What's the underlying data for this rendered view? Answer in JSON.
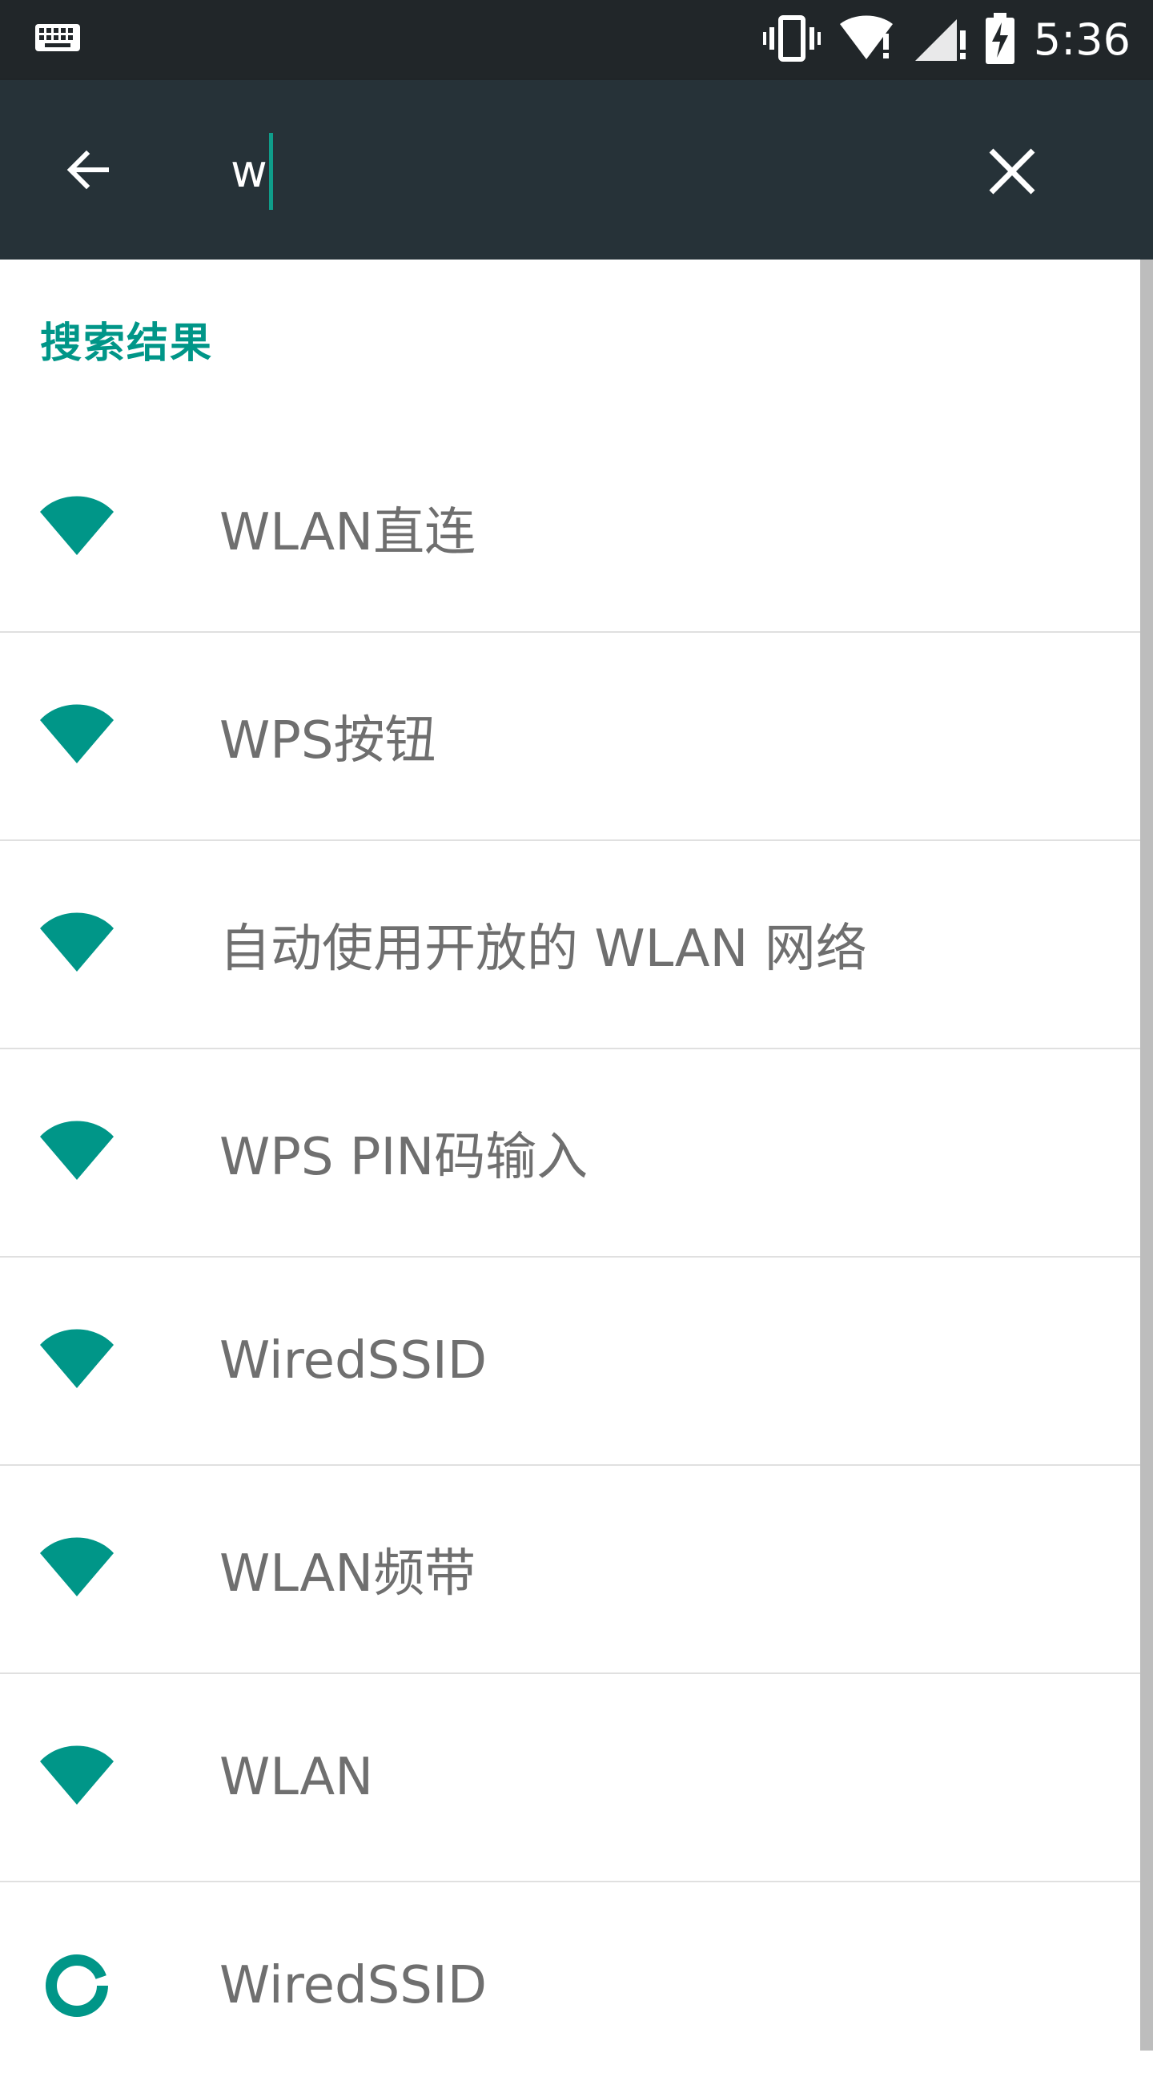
{
  "status_bar": {
    "time": "5:36",
    "icons": [
      "keyboard-icon",
      "vibrate-icon",
      "wifi-alert-icon",
      "signal-alert-icon",
      "battery-charging-icon"
    ]
  },
  "app_bar": {
    "search_value": "w",
    "back_icon": "arrow-left-icon",
    "clear_icon": "close-icon"
  },
  "content": {
    "section_title": "搜索结果",
    "items": [
      {
        "label": "WLAN直连",
        "icon": "wifi-icon"
      },
      {
        "label": "WPS按钮",
        "icon": "wifi-icon"
      },
      {
        "label": "自动使用开放的 WLAN 网络",
        "icon": "wifi-icon"
      },
      {
        "label": "WPS PIN码输入",
        "icon": "wifi-icon"
      },
      {
        "label": "WiredSSID",
        "icon": "wifi-icon"
      },
      {
        "label": "WLAN频带",
        "icon": "wifi-icon"
      },
      {
        "label": "WLAN",
        "icon": "wifi-icon"
      },
      {
        "label": "WiredSSID",
        "icon": "data-usage-icon"
      }
    ]
  },
  "colors": {
    "status_bar": "#212629",
    "app_bar": "#263238",
    "accent": "#009688",
    "item_text": "#6f6f6f",
    "divider": "#e0e0e0"
  }
}
